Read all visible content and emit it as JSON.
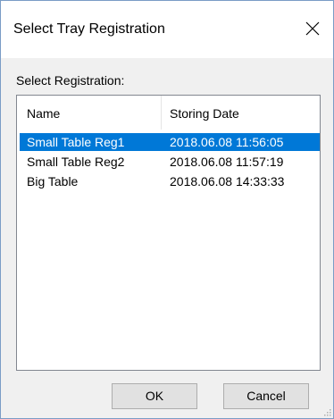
{
  "dialog": {
    "title": "Select Tray Registration",
    "close_icon": "close-icon"
  },
  "group_label": "Select Registration:",
  "list": {
    "columns": [
      "Name",
      "Storing Date"
    ],
    "rows": [
      {
        "name": "Small Table Reg1",
        "date": "2018.06.08 11:56:05",
        "selected": true
      },
      {
        "name": "Small Table Reg2",
        "date": "2018.06.08 11:57:19",
        "selected": false
      },
      {
        "name": "Big Table",
        "date": "2018.06.08 14:33:33",
        "selected": false
      }
    ],
    "selection_color": "#0078d7"
  },
  "buttons": {
    "ok": "OK",
    "cancel": "Cancel"
  }
}
